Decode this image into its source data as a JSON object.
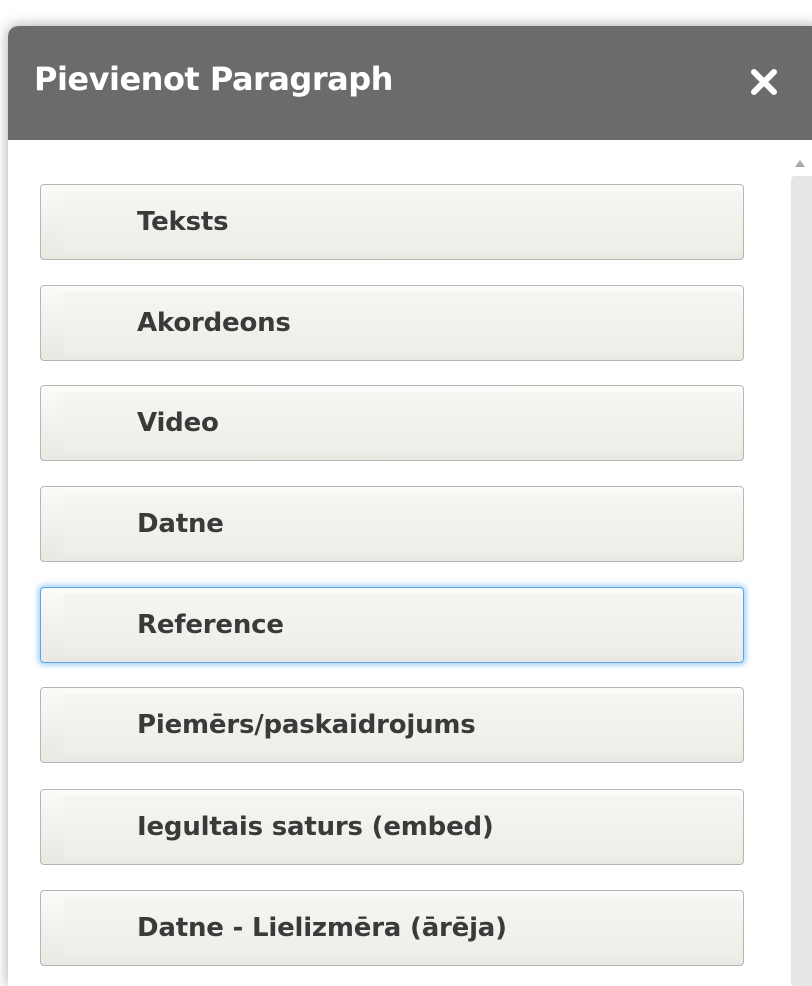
{
  "dialog": {
    "title": "Pievienot Paragraph",
    "close_label": "close"
  },
  "buttons": [
    {
      "label": "Teksts"
    },
    {
      "label": "Akordeons"
    },
    {
      "label": "Video"
    },
    {
      "label": "Datne"
    },
    {
      "label": "Reference",
      "focused": true
    },
    {
      "label": "Piemērs/paskaidrojums"
    },
    {
      "label": "Iegultais saturs (embed)"
    },
    {
      "label": "Datne - Lielizmēra (ārēja)"
    }
  ],
  "icons": {
    "close": "close-icon",
    "scroll_up": "scroll-up-arrow-icon"
  },
  "colors": {
    "titlebar": "#6b6b6b",
    "title_text": "#ffffff",
    "button_text": "#3a3a3a",
    "focus_ring": "#55a8e8"
  }
}
